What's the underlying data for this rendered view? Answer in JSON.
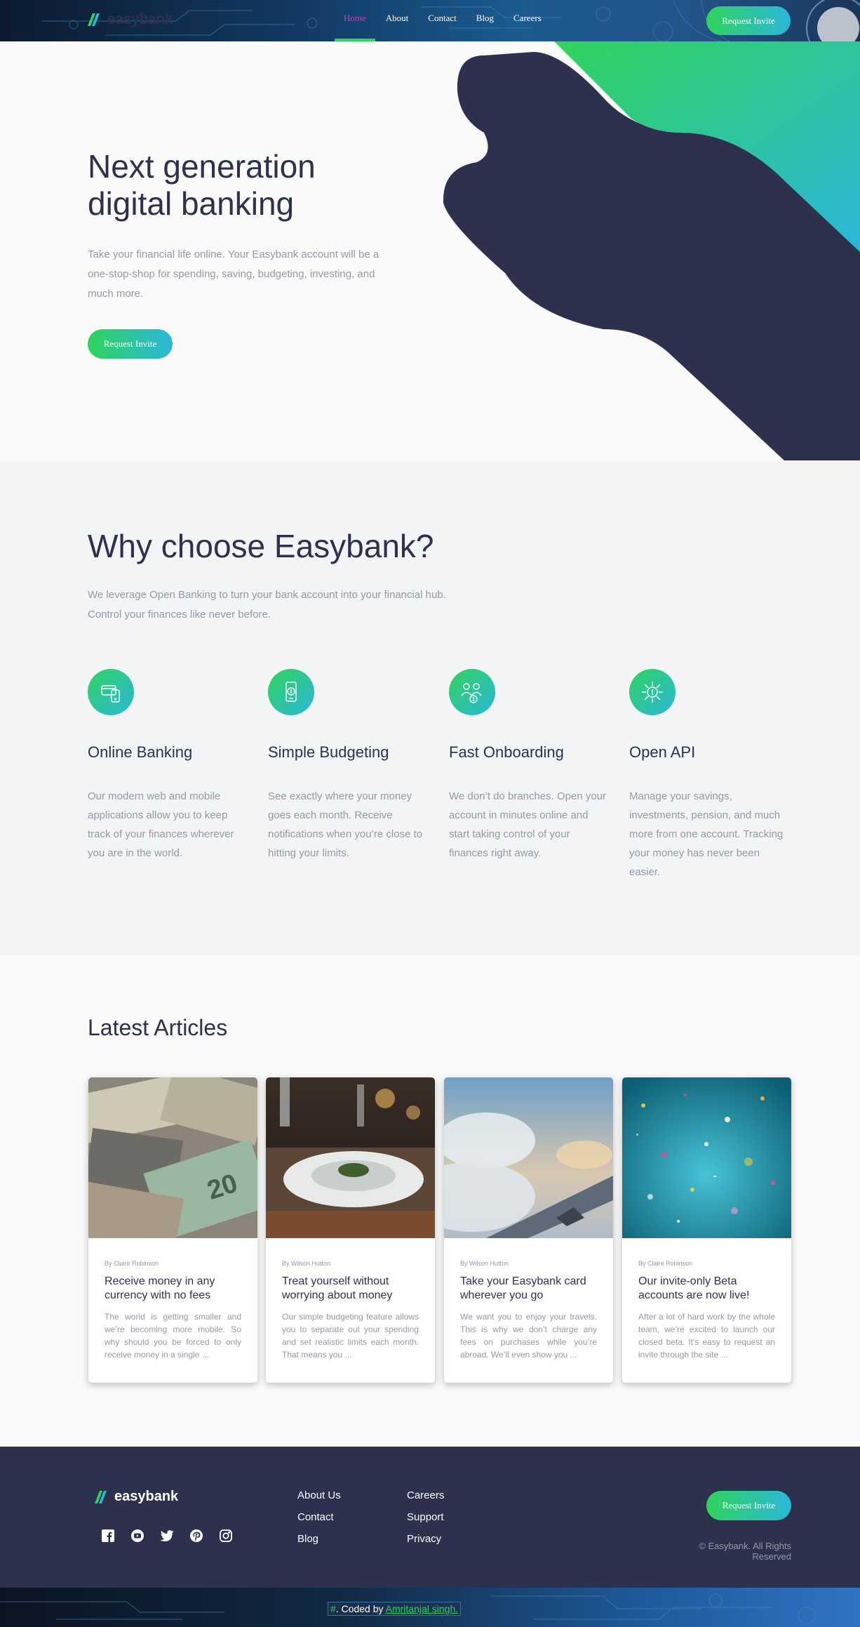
{
  "nav": {
    "brand": "easybank",
    "links": [
      "Home",
      "About",
      "Contact",
      "Blog",
      "Careers"
    ],
    "active_index": 0,
    "cta": "Request Invite"
  },
  "hero": {
    "title": "Next generation digital banking",
    "text": "Take your financial life online. Your Easybank account will be a one-stop-shop for spending, saving, budgeting, investing, and much more.",
    "cta": "Request Invite"
  },
  "why": {
    "title": "Why choose Easybank?",
    "intro": "We leverage Open Banking to turn your bank account into your financial hub. Control your finances like never before.",
    "features": [
      {
        "icon": "online-banking-icon",
        "title": "Online Banking",
        "text": "Our modern web and mobile applications allow you to keep track of your finances wherever you are in the world."
      },
      {
        "icon": "budgeting-icon",
        "title": "Simple Budgeting",
        "text": "See exactly where your money goes each month. Receive notifications when you’re close to hitting your limits."
      },
      {
        "icon": "onboarding-icon",
        "title": "Fast Onboarding",
        "text": "We don’t do branches. Open your account in minutes online and start taking control of your finances right away."
      },
      {
        "icon": "api-icon",
        "title": "Open API",
        "text": "Manage your savings, investments, pension, and much more from one account. Tracking your money has never been easier."
      }
    ]
  },
  "articles": {
    "title": "Latest Articles",
    "items": [
      {
        "image": "currency-photo",
        "author": "By Claire Robinson",
        "title": "Receive money in any currency with no fees",
        "excerpt": "The world is getting smaller and we’re becoming more mobile. So why should you be forced to only receive money in a single ..."
      },
      {
        "image": "restaurant-photo",
        "author": "By Wilson Hutton",
        "title": "Treat yourself without worrying about money",
        "excerpt": "Our simple budgeting feature allows you to separate out your spending and set realistic limits each month. That means you ..."
      },
      {
        "image": "plane-photo",
        "author": "By Wilson Hutton",
        "title": "Take your Easybank card wherever you go",
        "excerpt": "We want you to enjoy your travels. This is why we don’t charge any fees on purchases while you’re abroad. We’ll even show you ..."
      },
      {
        "image": "confetti-photo",
        "author": "By Claire Robinson",
        "title": "Our invite-only Beta accounts are now live!",
        "excerpt": "After a lot of hard work by the whole team, we’re excited to launch our closed beta. It’s easy to request an invite through the site ..."
      }
    ]
  },
  "footer": {
    "brand": "easybank",
    "socials": [
      "facebook-icon",
      "youtube-icon",
      "twitter-icon",
      "pinterest-icon",
      "instagram-icon"
    ],
    "col1": [
      "About Us",
      "Contact",
      "Blog"
    ],
    "col2": [
      "Careers",
      "Support",
      "Privacy"
    ],
    "cta": "Request Invite",
    "copyright": "© Easybank. All Rights Reserved"
  },
  "credit": {
    "prefix": "#",
    "text": ". Coded by ",
    "author": "Amritanjal singh."
  },
  "colors": {
    "dark_blue": "#2d314d",
    "lime_green": "#31d35c",
    "bright_cyan": "#2bb7da",
    "grayish_blue": "#9698a6",
    "light_gray": "#f3f4f6"
  }
}
